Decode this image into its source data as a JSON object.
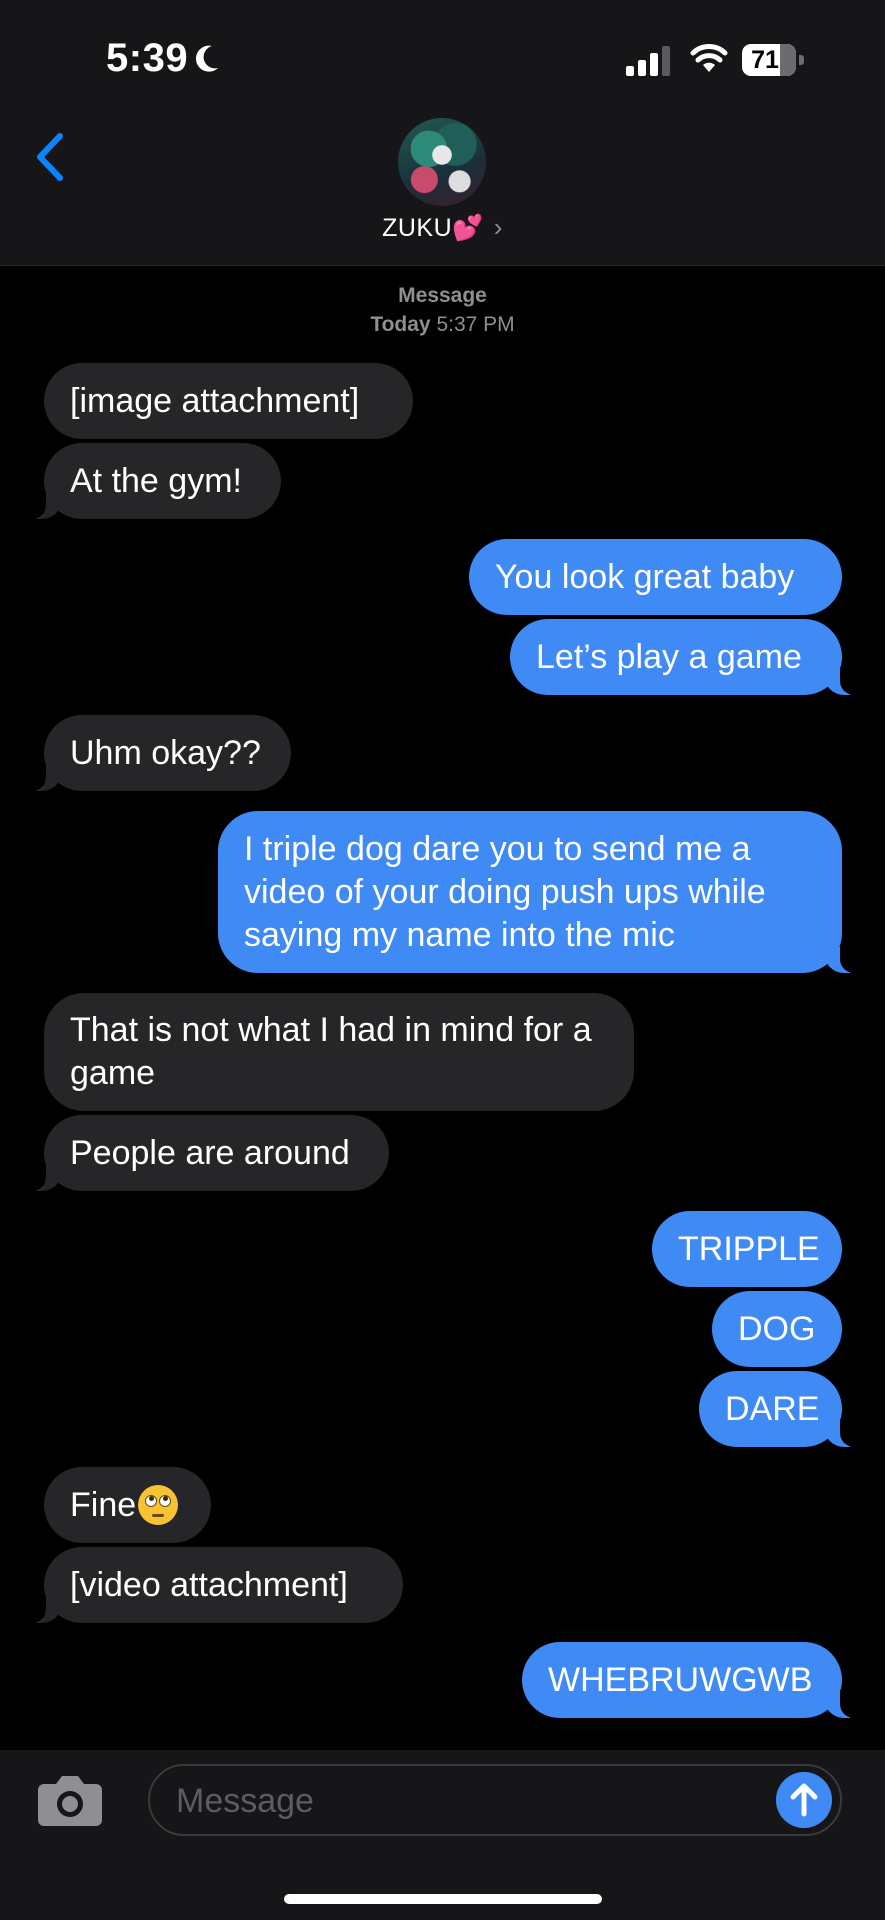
{
  "status_bar": {
    "time": "5:39",
    "battery_level": "71",
    "battery_fraction": 0.71
  },
  "header": {
    "contact_name": "ZUKU💕",
    "chevron": "›"
  },
  "thread": {
    "service_label": "Message",
    "day_label": "Today",
    "time_label": "5:37 PM",
    "messages": [
      {
        "from": "them",
        "text": "[image attachment]"
      },
      {
        "from": "them",
        "text": "At the gym!"
      },
      {
        "from": "me",
        "text": "You look great baby"
      },
      {
        "from": "me",
        "text": "Let’s play a game"
      },
      {
        "from": "them",
        "text": "Uhm okay??"
      },
      {
        "from": "me",
        "text": "I triple dog dare you to send me a video of your doing push ups while saying my name into the mic"
      },
      {
        "from": "them",
        "text": "That is not what I had in mind for a game"
      },
      {
        "from": "them",
        "text": "People are around"
      },
      {
        "from": "me",
        "text": "TRIPPLE"
      },
      {
        "from": "me",
        "text": "DOG"
      },
      {
        "from": "me",
        "text": "DARE"
      },
      {
        "from": "them",
        "text": "Fine"
      },
      {
        "from": "them",
        "text": "[video attachment]"
      },
      {
        "from": "me",
        "text": "WHEBRUWGWB"
      }
    ]
  },
  "input": {
    "placeholder": "Message"
  },
  "icons": {
    "back": "chevron-left-icon",
    "camera": "camera-icon",
    "send": "arrow-up-icon",
    "moon": "moon-icon",
    "signal": "cellular-signal-icon",
    "wifi": "wifi-icon",
    "battery": "battery-icon",
    "eye_roll": "face-with-rolling-eyes-emoji"
  },
  "colors": {
    "outgoing_bubble": "#3f8af5",
    "incoming_bubble": "#262628",
    "background": "#000000",
    "accent": "#0a84ff"
  }
}
